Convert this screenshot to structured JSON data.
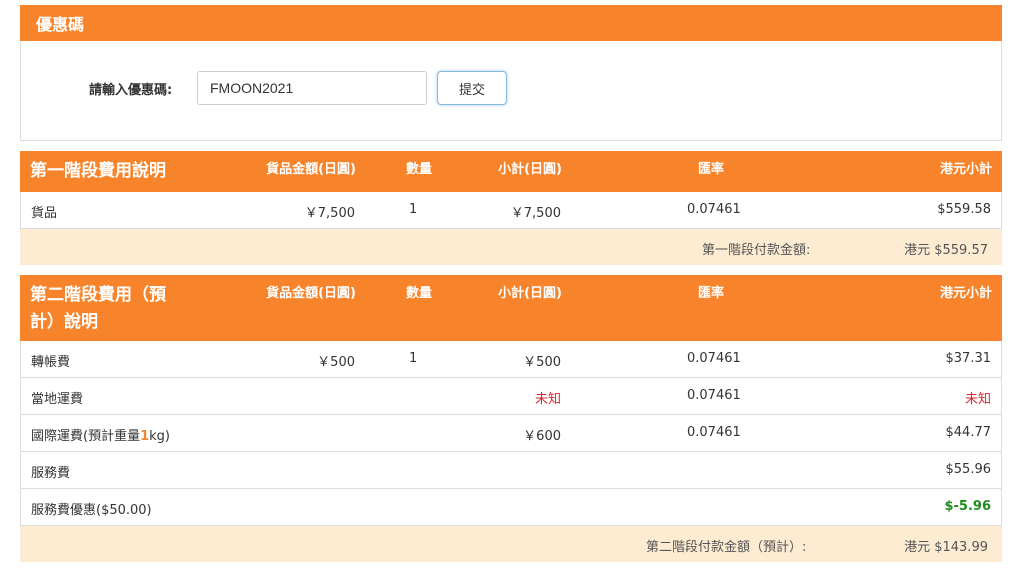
{
  "coupon": {
    "title": "優惠碼",
    "label": "請輸入優惠碼:",
    "value": "FMOON2021",
    "submit_label": "提交"
  },
  "columns": {
    "goods_amount": "貨品金額(日圓)",
    "quantity": "數量",
    "subtotal_jpy": "小計(日圓)",
    "rate": "匯率",
    "subtotal_hkd": "港元小計"
  },
  "stage1": {
    "title": "第一階段費用說明",
    "rows": [
      {
        "name": "貨品",
        "amount": "￥7,500",
        "qty": "1",
        "subtotal": "￥7,500",
        "rate": "0.07461",
        "hkd": "$559.58"
      }
    ],
    "total_label": "第一階段付款金額:",
    "total_value": "港元 $559.57"
  },
  "stage2": {
    "title_line1": "第二階段費用（預",
    "title_line2": "計）說明",
    "rows": [
      {
        "name": "轉帳費",
        "amount": "￥500",
        "qty": "1",
        "subtotal": "￥500",
        "rate": "0.07461",
        "hkd": "$37.31"
      },
      {
        "name": "當地運費",
        "amount": "",
        "qty": "",
        "subtotal": "未知",
        "rate": "0.07461",
        "hkd": "未知"
      },
      {
        "name_prefix": "國際運費(預計重量",
        "name_weight": "1",
        "name_suffix": "kg)",
        "amount": "",
        "qty": "",
        "subtotal": "￥600",
        "rate": "0.07461",
        "hkd": "$44.77"
      },
      {
        "name": "服務費",
        "amount": "",
        "qty": "",
        "subtotal": "",
        "rate": "",
        "hkd": "$55.96"
      },
      {
        "name": "服務費優惠($50.00)",
        "amount": "",
        "qty": "",
        "subtotal": "",
        "rate": "",
        "hkd": "$-5.96"
      }
    ],
    "total_label": "第二階段付款金額（預計）:",
    "total_value": "港元 $143.99"
  },
  "colors": {
    "accent": "#f7842a",
    "total_bg": "#fdebd2",
    "unknown": "#d9232e",
    "discount": "#1e8c1e"
  }
}
